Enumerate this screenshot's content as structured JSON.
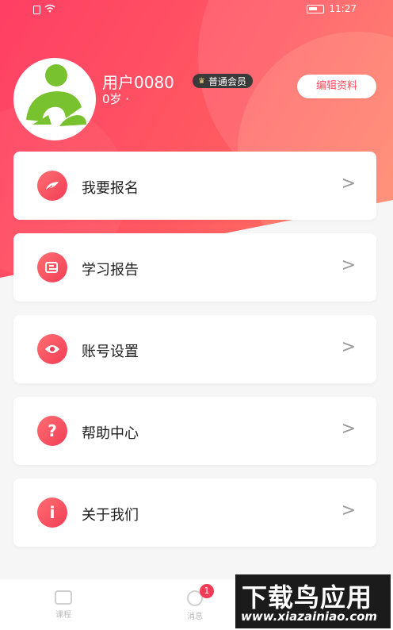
{
  "status_bar": {
    "time": "11:27"
  },
  "profile": {
    "username": "用户0080",
    "meta": "0岁 ·",
    "member_badge": "普通会员",
    "edit_button": "编辑资料"
  },
  "menu": [
    {
      "label": "我要报名",
      "icon": "pen-icon"
    },
    {
      "label": "学习报告",
      "icon": "report-icon"
    },
    {
      "label": "账号设置",
      "icon": "eye-icon"
    },
    {
      "label": "帮助中心",
      "icon": "question-icon",
      "glyph": "?"
    },
    {
      "label": "关于我们",
      "icon": "info-icon",
      "glyph": "i"
    }
  ],
  "chevron": ">",
  "tabbar": {
    "tabs": [
      {
        "label": "课程"
      },
      {
        "label": "消息",
        "badge": "1"
      }
    ]
  },
  "watermark": {
    "title": "下载鸟应用",
    "url": "www.xiazainiao.com"
  },
  "colors": {
    "accent": "#f23c55",
    "gradient_start": "#ff3f64",
    "gradient_end": "#ff7d5e"
  }
}
